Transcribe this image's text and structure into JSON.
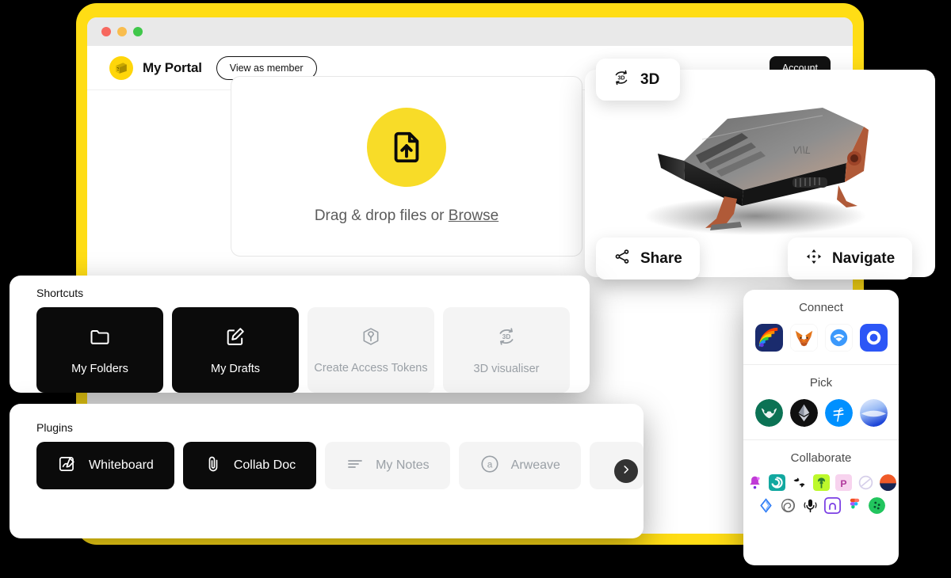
{
  "window": {
    "traffic_lights": [
      "close",
      "minimize",
      "maximize"
    ],
    "frame_color": "#FFDD15",
    "titlebar_color": "#E9E9E9"
  },
  "topbar": {
    "brand_title": "My Portal",
    "brand_logo_icon": "3d-box-face-logo",
    "view_as_member_label": "View as member",
    "account_label": "Account"
  },
  "upload": {
    "icon": "file-upload-icon",
    "circle_color": "#F8DC28",
    "text_prefix": "Drag & drop files or ",
    "browse_label": "Browse"
  },
  "viewer": {
    "badge_label": "3D",
    "badge_icon": "rotate-3d-icon",
    "share_label": "Share",
    "share_icon": "share-nodes-icon",
    "navigate_label": "Navigate",
    "navigate_icon": "move-arrows-icon",
    "model_description": "3D faceted vehicle model"
  },
  "shortcuts": {
    "title": "Shortcuts",
    "items": [
      {
        "label": "My Folders",
        "icon": "folder-icon",
        "style": "dark"
      },
      {
        "label": "My Drafts",
        "icon": "edit-square-icon",
        "style": "dark"
      },
      {
        "label": "Create Access Tokens",
        "icon": "token-cube-icon",
        "style": "light"
      },
      {
        "label": "3D visualiser",
        "icon": "rotate-3d-icon",
        "style": "light"
      }
    ]
  },
  "plugins": {
    "title": "Plugins",
    "items": [
      {
        "label": "Whiteboard",
        "icon": "pen-square-icon",
        "style": "dark"
      },
      {
        "label": "Collab Doc",
        "icon": "paperclip-icon",
        "style": "dark"
      },
      {
        "label": "My Notes",
        "icon": "text-lines-icon",
        "style": "light"
      },
      {
        "label": "Arweave",
        "icon": "arweave-a-icon",
        "style": "light"
      }
    ],
    "next_icon": "chevron-right-icon"
  },
  "wallet_panel": {
    "connect": {
      "title": "Connect",
      "items": [
        {
          "name": "rainbow-wallet-icon",
          "color": "#1A2B6D"
        },
        {
          "name": "metamask-fox-icon",
          "color": "#FFFFFF"
        },
        {
          "name": "walletconnect-icon",
          "color": "#FFFFFF"
        },
        {
          "name": "coinbase-wallet-icon",
          "color": "#2C56F6"
        }
      ]
    },
    "pick": {
      "title": "Pick",
      "items": [
        {
          "name": "owl-green-icon",
          "color": "#0B7254"
        },
        {
          "name": "ethereum-icon",
          "color": "#101010"
        },
        {
          "name": "filecoin-icon",
          "color": "#118C8"
        },
        {
          "name": "gradient-sphere-icon",
          "color": "#1E5BE8"
        }
      ]
    },
    "collaborate": {
      "title": "Collaborate",
      "row1": [
        {
          "name": "purple-bell-icon",
          "color": "#C03BD6"
        },
        {
          "name": "teal-spiral-icon",
          "color": "#12A8A0"
        },
        {
          "name": "black-glyph-icon",
          "color": "#111111"
        },
        {
          "name": "lime-tree-icon",
          "color": "#BDF92C"
        },
        {
          "name": "pink-p-icon",
          "color": "#F4C6E8"
        },
        {
          "name": "faded-circle-slash-icon",
          "color": "#E5E0F0"
        },
        {
          "name": "orange-navy-circle-icon",
          "color": "#F05A28"
        }
      ],
      "row2": [
        {
          "name": "blue-diamond-icon",
          "color": "#2F7DF6"
        },
        {
          "name": "openai-spiral-icon",
          "color": "#6E6E6E"
        },
        {
          "name": "microphone-icon",
          "color": "#111111"
        },
        {
          "name": "purple-arch-icon",
          "color": "#7B3FE4"
        },
        {
          "name": "figma-icon",
          "color": "#F24E1E"
        },
        {
          "name": "green-dots-icon",
          "color": "#22C55E"
        }
      ]
    }
  }
}
